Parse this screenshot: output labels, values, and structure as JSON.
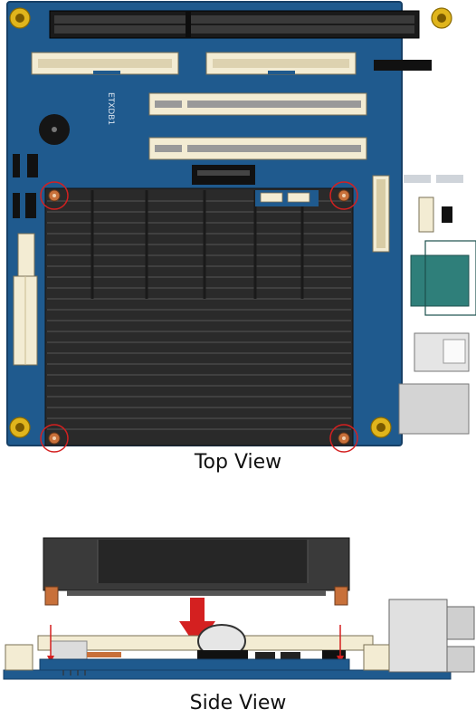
{
  "captions": {
    "top_view": "Top View",
    "side_view": "Side View"
  },
  "board_label": "ETXDB1",
  "colors": {
    "pcb_blue": "#1f5a8e",
    "heatsink_black": "#2a2a2a",
    "slot_ivory": "#f3ecd3",
    "screw_gold": "#e0b51c",
    "marker_red": "#d42020",
    "vga_teal": "#2f7f7a",
    "standoff_copper": "#c8703a"
  }
}
